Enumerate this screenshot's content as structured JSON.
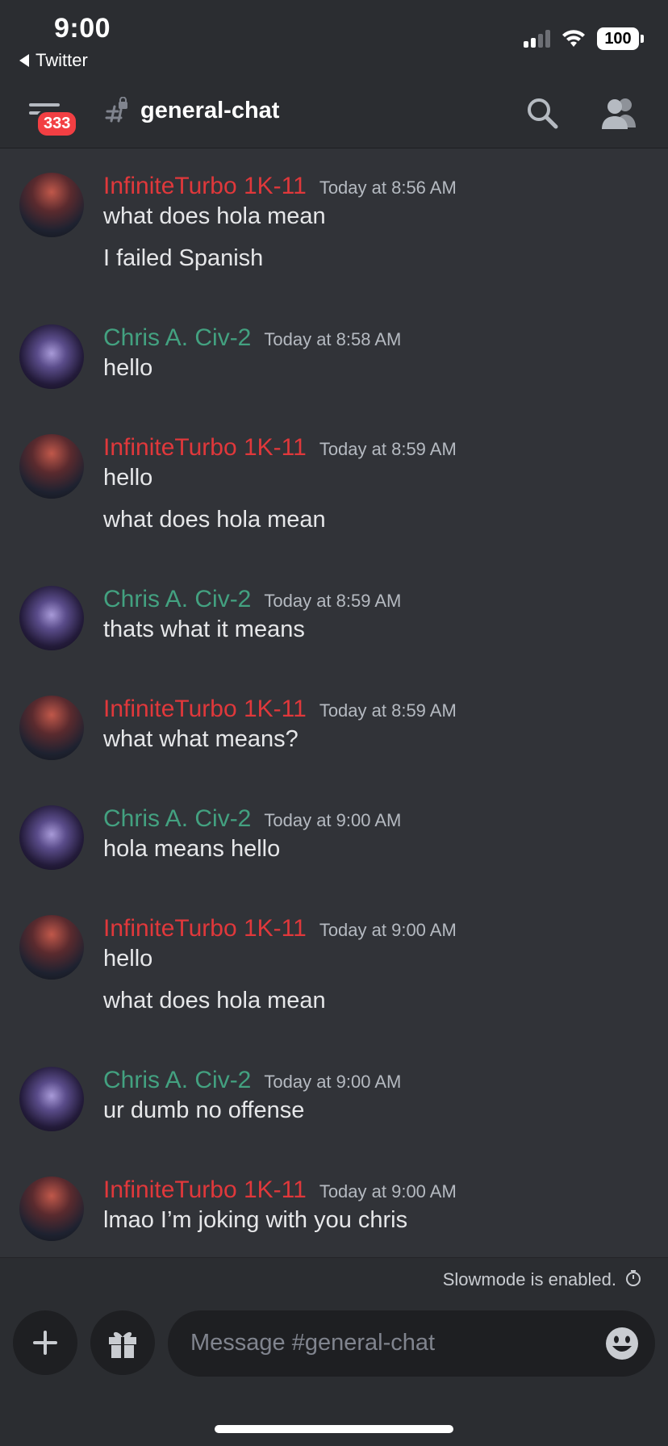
{
  "status_bar": {
    "time": "9:00",
    "back_app": "Twitter",
    "battery": "100"
  },
  "header": {
    "badge_count": "333",
    "channel_name": "general-chat"
  },
  "messages": [
    {
      "author": "InfiniteTurbo 1K-11",
      "time": "Today at 8:56 AM",
      "lines": [
        "what does hola mean",
        "I failed Spanish"
      ]
    },
    {
      "author": "Chris A. Civ-2",
      "time": "Today at 8:58 AM",
      "lines": [
        "hello"
      ]
    },
    {
      "author": "InfiniteTurbo 1K-11",
      "time": "Today at 8:59 AM",
      "lines": [
        "hello",
        "what does hola mean"
      ]
    },
    {
      "author": "Chris A. Civ-2",
      "time": "Today at 8:59 AM",
      "lines": [
        "thats what it means"
      ]
    },
    {
      "author": "InfiniteTurbo 1K-11",
      "time": "Today at 8:59 AM",
      "lines": [
        "what what means?"
      ]
    },
    {
      "author": "Chris A. Civ-2",
      "time": "Today at 9:00 AM",
      "lines": [
        "hola means hello"
      ]
    },
    {
      "author": "InfiniteTurbo 1K-11",
      "time": "Today at 9:00 AM",
      "lines": [
        "hello",
        "what does hola mean"
      ]
    },
    {
      "author": "Chris A. Civ-2",
      "time": "Today at 9:00 AM",
      "lines": [
        "ur dumb no offense"
      ]
    },
    {
      "author": "InfiniteTurbo 1K-11",
      "time": "Today at 9:00 AM",
      "lines": [
        "lmao I’m joking with you chris"
      ]
    }
  ],
  "slowmode": {
    "text": "Slowmode is enabled."
  },
  "composer": {
    "placeholder": "Message #general-chat"
  },
  "colors": {
    "background": "#313338",
    "header": "#2b2d31",
    "user_red": "#e0383b",
    "user_green": "#43a180",
    "badge": "#f23f43"
  }
}
